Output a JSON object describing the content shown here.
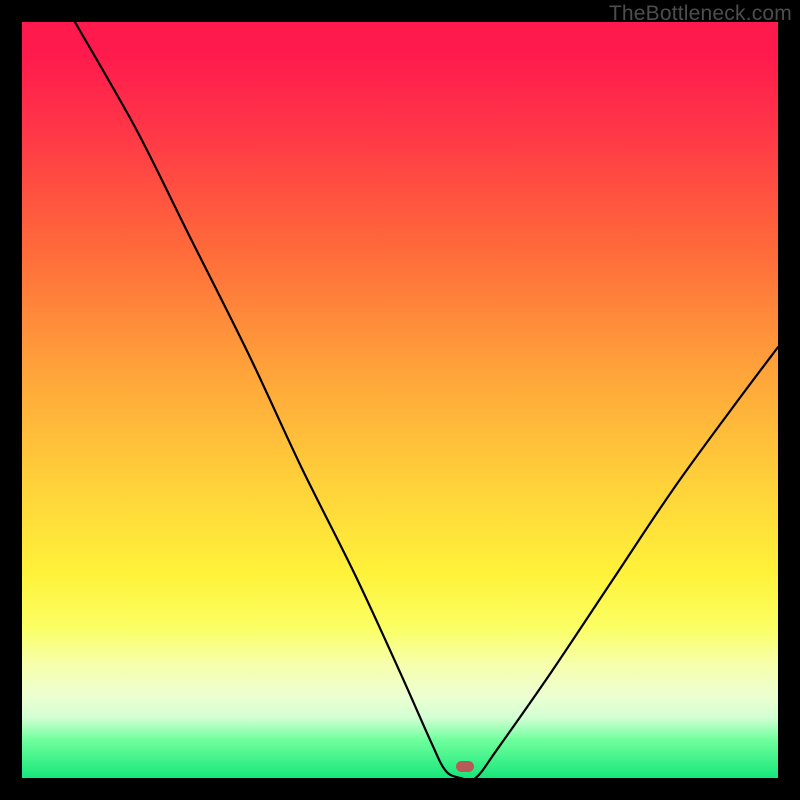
{
  "watermark": "TheBottleneck.com",
  "marker": {
    "x_pct": 58.6,
    "y_pct": 98.5
  },
  "chart_data": {
    "type": "line",
    "title": "",
    "xlabel": "",
    "ylabel": "",
    "xlim": [
      0,
      100
    ],
    "ylim": [
      0,
      100
    ],
    "series": [
      {
        "name": "bottleneck-curve",
        "x": [
          7,
          15,
          22,
          30,
          37,
          44,
          50,
          54,
          56,
          58,
          60,
          63,
          70,
          78,
          86,
          94,
          100
        ],
        "values": [
          100,
          86,
          72,
          56,
          41,
          27,
          14,
          5,
          1,
          0,
          0,
          4,
          14,
          26,
          38,
          49,
          57
        ]
      }
    ],
    "marker_point": {
      "x": 58.6,
      "y": 1.5
    },
    "background_gradient": {
      "top": "#ff1a4d",
      "mid_upper": "#ffa63a",
      "mid": "#fff23a",
      "mid_lower": "#f6ffab",
      "bottom": "#16e67a"
    }
  }
}
